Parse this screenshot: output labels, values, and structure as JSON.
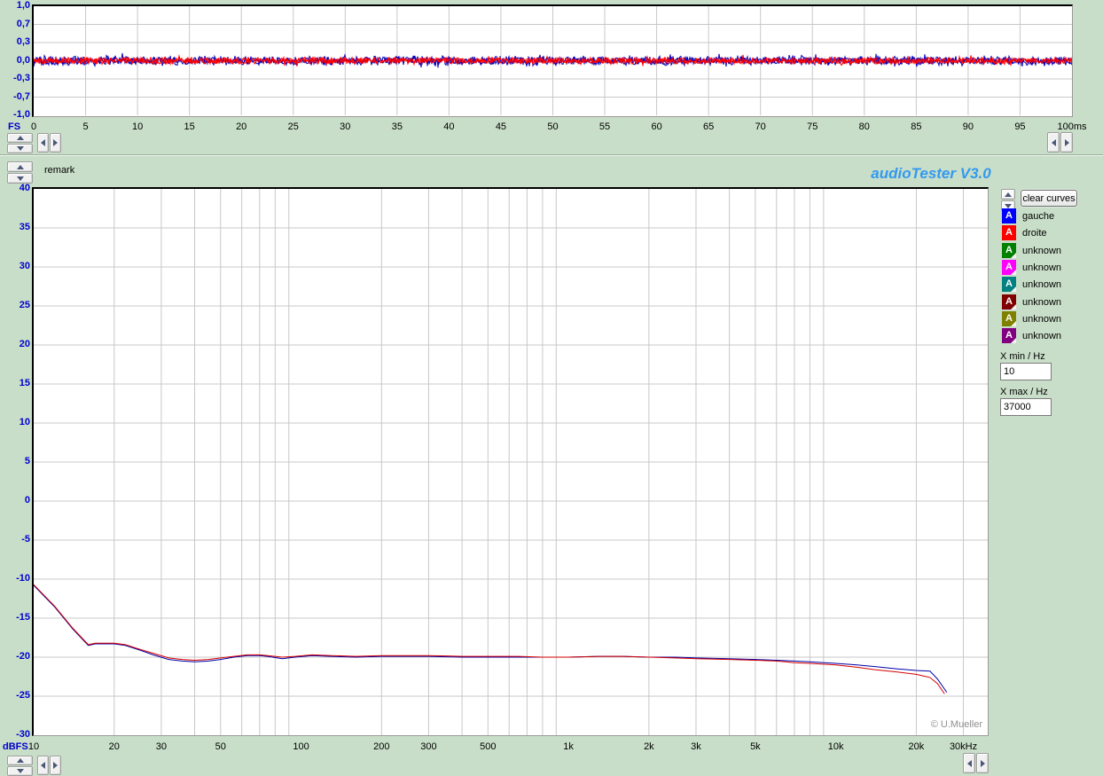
{
  "window": {
    "title": "audioTester  V3.0",
    "title_color": "#3399ee",
    "background_color": "#c8dec8",
    "remark_label": "remark",
    "copyright": "© U.Mueller"
  },
  "time_chart": {
    "y_unit_label": "FS",
    "y_ticks": [
      {
        "v": 1.0,
        "t": "1,0"
      },
      {
        "v": 0.7,
        "t": "0,7"
      },
      {
        "v": 0.3,
        "t": "0,3"
      },
      {
        "v": 0.0,
        "t": "0,0"
      },
      {
        "v": -0.3,
        "t": "-0,3"
      },
      {
        "v": -0.7,
        "t": "-0,7"
      },
      {
        "v": -1.0,
        "t": "-1,0"
      }
    ],
    "x_ticks": [
      {
        "v": 0,
        "t": "0"
      },
      {
        "v": 5,
        "t": "5"
      },
      {
        "v": 10,
        "t": "10"
      },
      {
        "v": 15,
        "t": "15"
      },
      {
        "v": 20,
        "t": "20"
      },
      {
        "v": 25,
        "t": "25"
      },
      {
        "v": 30,
        "t": "30"
      },
      {
        "v": 35,
        "t": "35"
      },
      {
        "v": 40,
        "t": "40"
      },
      {
        "v": 45,
        "t": "45"
      },
      {
        "v": 50,
        "t": "50"
      },
      {
        "v": 55,
        "t": "55"
      },
      {
        "v": 60,
        "t": "60"
      },
      {
        "v": 65,
        "t": "65"
      },
      {
        "v": 70,
        "t": "70"
      },
      {
        "v": 75,
        "t": "75"
      },
      {
        "v": 80,
        "t": "80"
      },
      {
        "v": 85,
        "t": "85"
      },
      {
        "v": 90,
        "t": "90"
      },
      {
        "v": 95,
        "t": "95"
      },
      {
        "v": 100,
        "t": "100ms"
      }
    ]
  },
  "freq_chart": {
    "y_unit_label": "dBFS",
    "y_ticks": [
      {
        "v": 40,
        "t": "40"
      },
      {
        "v": 35,
        "t": "35"
      },
      {
        "v": 30,
        "t": "30"
      },
      {
        "v": 25,
        "t": "25"
      },
      {
        "v": 20,
        "t": "20"
      },
      {
        "v": 15,
        "t": "15"
      },
      {
        "v": 10,
        "t": "10"
      },
      {
        "v": 5,
        "t": "5"
      },
      {
        "v": 0,
        "t": "0"
      },
      {
        "v": -5,
        "t": "-5"
      },
      {
        "v": -10,
        "t": "-10"
      },
      {
        "v": -15,
        "t": "-15"
      },
      {
        "v": -20,
        "t": "-20"
      },
      {
        "v": -25,
        "t": "-25"
      },
      {
        "v": -30,
        "t": "-30"
      }
    ],
    "x_ticks": [
      {
        "f": 10,
        "t": "10"
      },
      {
        "f": 20,
        "t": "20"
      },
      {
        "f": 30,
        "t": "30"
      },
      {
        "f": 50,
        "t": "50"
      },
      {
        "f": 100,
        "t": "100"
      },
      {
        "f": 200,
        "t": "200"
      },
      {
        "f": 300,
        "t": "300"
      },
      {
        "f": 500,
        "t": "500"
      },
      {
        "f": 1000,
        "t": "1k"
      },
      {
        "f": 2000,
        "t": "2k"
      },
      {
        "f": 3000,
        "t": "3k"
      },
      {
        "f": 5000,
        "t": "5k"
      },
      {
        "f": 10000,
        "t": "10k"
      },
      {
        "f": 20000,
        "t": "20k"
      },
      {
        "f": 30000,
        "t": "30kHz"
      }
    ]
  },
  "legend": {
    "clear_button_label": "clear curves",
    "items": [
      {
        "label": "gauche",
        "color": "#0000ff",
        "folded": false
      },
      {
        "label": "droite",
        "color": "#ff0000",
        "folded": false
      },
      {
        "label": "unknown",
        "color": "#008000",
        "folded": true
      },
      {
        "label": "unknown",
        "color": "#ff00ff",
        "folded": true
      },
      {
        "label": "unknown",
        "color": "#008080",
        "folded": true
      },
      {
        "label": "unknown",
        "color": "#800000",
        "folded": true
      },
      {
        "label": "unknown",
        "color": "#808000",
        "folded": true
      },
      {
        "label": "unknown",
        "color": "#800080",
        "folded": true
      }
    ],
    "xmin_label": "X min / Hz",
    "xmin_value": "10",
    "xmax_label": "X max / Hz",
    "xmax_value": "37000"
  },
  "chart_data": [
    {
      "type": "line",
      "title": "time signal",
      "xlabel": "ms",
      "ylabel": "FS",
      "xlim": [
        0,
        100
      ],
      "ylim": [
        -1.0,
        1.0
      ],
      "y_tick_values": [
        1.0,
        0.7,
        0.3,
        0.0,
        -0.3,
        -0.7,
        -1.0
      ],
      "grid": true,
      "series": [
        {
          "name": "gauche",
          "color": "#0000bb",
          "shape": "noise",
          "center": 0.0,
          "peak_amplitude": 0.09
        },
        {
          "name": "droite",
          "color": "#ff0000",
          "shape": "noise",
          "center": 0.0,
          "peak_amplitude": 0.065
        }
      ]
    },
    {
      "type": "line",
      "title": "frequency response",
      "xlabel": "Hz",
      "ylabel": "dBFS",
      "x_scale": "log",
      "xlim": [
        10,
        37000
      ],
      "ylim": [
        -30,
        40
      ],
      "grid": true,
      "legend_position": "right",
      "series": [
        {
          "name": "gauche",
          "color": "#0000a8",
          "points": [
            [
              10,
              -10.8
            ],
            [
              12,
              -13.6
            ],
            [
              14,
              -16.4
            ],
            [
              16,
              -18.5
            ],
            [
              17,
              -18.3
            ],
            [
              20,
              -18.3
            ],
            [
              22,
              -18.5
            ],
            [
              25,
              -19.1
            ],
            [
              28,
              -19.7
            ],
            [
              32,
              -20.3
            ],
            [
              36,
              -20.5
            ],
            [
              40,
              -20.6
            ],
            [
              45,
              -20.5
            ],
            [
              50,
              -20.3
            ],
            [
              56,
              -20.0
            ],
            [
              63,
              -19.8
            ],
            [
              70,
              -19.8
            ],
            [
              75,
              -19.9
            ],
            [
              85,
              -20.2
            ],
            [
              95,
              -20.0
            ],
            [
              110,
              -19.8
            ],
            [
              130,
              -19.9
            ],
            [
              160,
              -20.0
            ],
            [
              200,
              -19.9
            ],
            [
              250,
              -19.9
            ],
            [
              300,
              -19.9
            ],
            [
              400,
              -20.0
            ],
            [
              500,
              -20.0
            ],
            [
              650,
              -20.0
            ],
            [
              800,
              -20.0
            ],
            [
              1000,
              -20.0
            ],
            [
              1300,
              -19.9
            ],
            [
              1600,
              -19.9
            ],
            [
              2000,
              -20.0
            ],
            [
              2500,
              -20.0
            ],
            [
              3000,
              -20.1
            ],
            [
              4000,
              -20.2
            ],
            [
              5000,
              -20.3
            ],
            [
              6000,
              -20.4
            ],
            [
              7000,
              -20.5
            ],
            [
              8000,
              -20.6
            ],
            [
              10000,
              -20.8
            ],
            [
              12000,
              -21.0
            ],
            [
              14000,
              -21.2
            ],
            [
              17000,
              -21.5
            ],
            [
              20000,
              -21.7
            ],
            [
              22500,
              -21.8
            ],
            [
              24000,
              -22.8
            ],
            [
              26000,
              -24.5
            ]
          ]
        },
        {
          "name": "droite",
          "color": "#d40000",
          "points": [
            [
              10,
              -10.7
            ],
            [
              12,
              -13.5
            ],
            [
              14,
              -16.3
            ],
            [
              16,
              -18.4
            ],
            [
              17,
              -18.2
            ],
            [
              20,
              -18.2
            ],
            [
              22,
              -18.4
            ],
            [
              25,
              -19.0
            ],
            [
              28,
              -19.5
            ],
            [
              32,
              -20.1
            ],
            [
              36,
              -20.3
            ],
            [
              40,
              -20.4
            ],
            [
              45,
              -20.3
            ],
            [
              50,
              -20.1
            ],
            [
              56,
              -19.9
            ],
            [
              63,
              -19.7
            ],
            [
              70,
              -19.7
            ],
            [
              75,
              -19.8
            ],
            [
              85,
              -20.0
            ],
            [
              95,
              -19.9
            ],
            [
              110,
              -19.7
            ],
            [
              130,
              -19.8
            ],
            [
              160,
              -19.9
            ],
            [
              200,
              -19.8
            ],
            [
              250,
              -19.8
            ],
            [
              300,
              -19.8
            ],
            [
              400,
              -19.9
            ],
            [
              500,
              -19.9
            ],
            [
              650,
              -19.9
            ],
            [
              800,
              -20.0
            ],
            [
              1000,
              -20.0
            ],
            [
              1300,
              -19.9
            ],
            [
              1600,
              -19.9
            ],
            [
              2000,
              -20.0
            ],
            [
              2500,
              -20.1
            ],
            [
              3000,
              -20.2
            ],
            [
              4000,
              -20.3
            ],
            [
              5000,
              -20.4
            ],
            [
              6000,
              -20.5
            ],
            [
              7000,
              -20.7
            ],
            [
              8000,
              -20.8
            ],
            [
              10000,
              -21.0
            ],
            [
              12000,
              -21.3
            ],
            [
              14000,
              -21.6
            ],
            [
              17000,
              -21.9
            ],
            [
              20000,
              -22.2
            ],
            [
              22500,
              -22.6
            ],
            [
              24000,
              -23.4
            ],
            [
              25500,
              -24.7
            ]
          ]
        }
      ]
    }
  ]
}
